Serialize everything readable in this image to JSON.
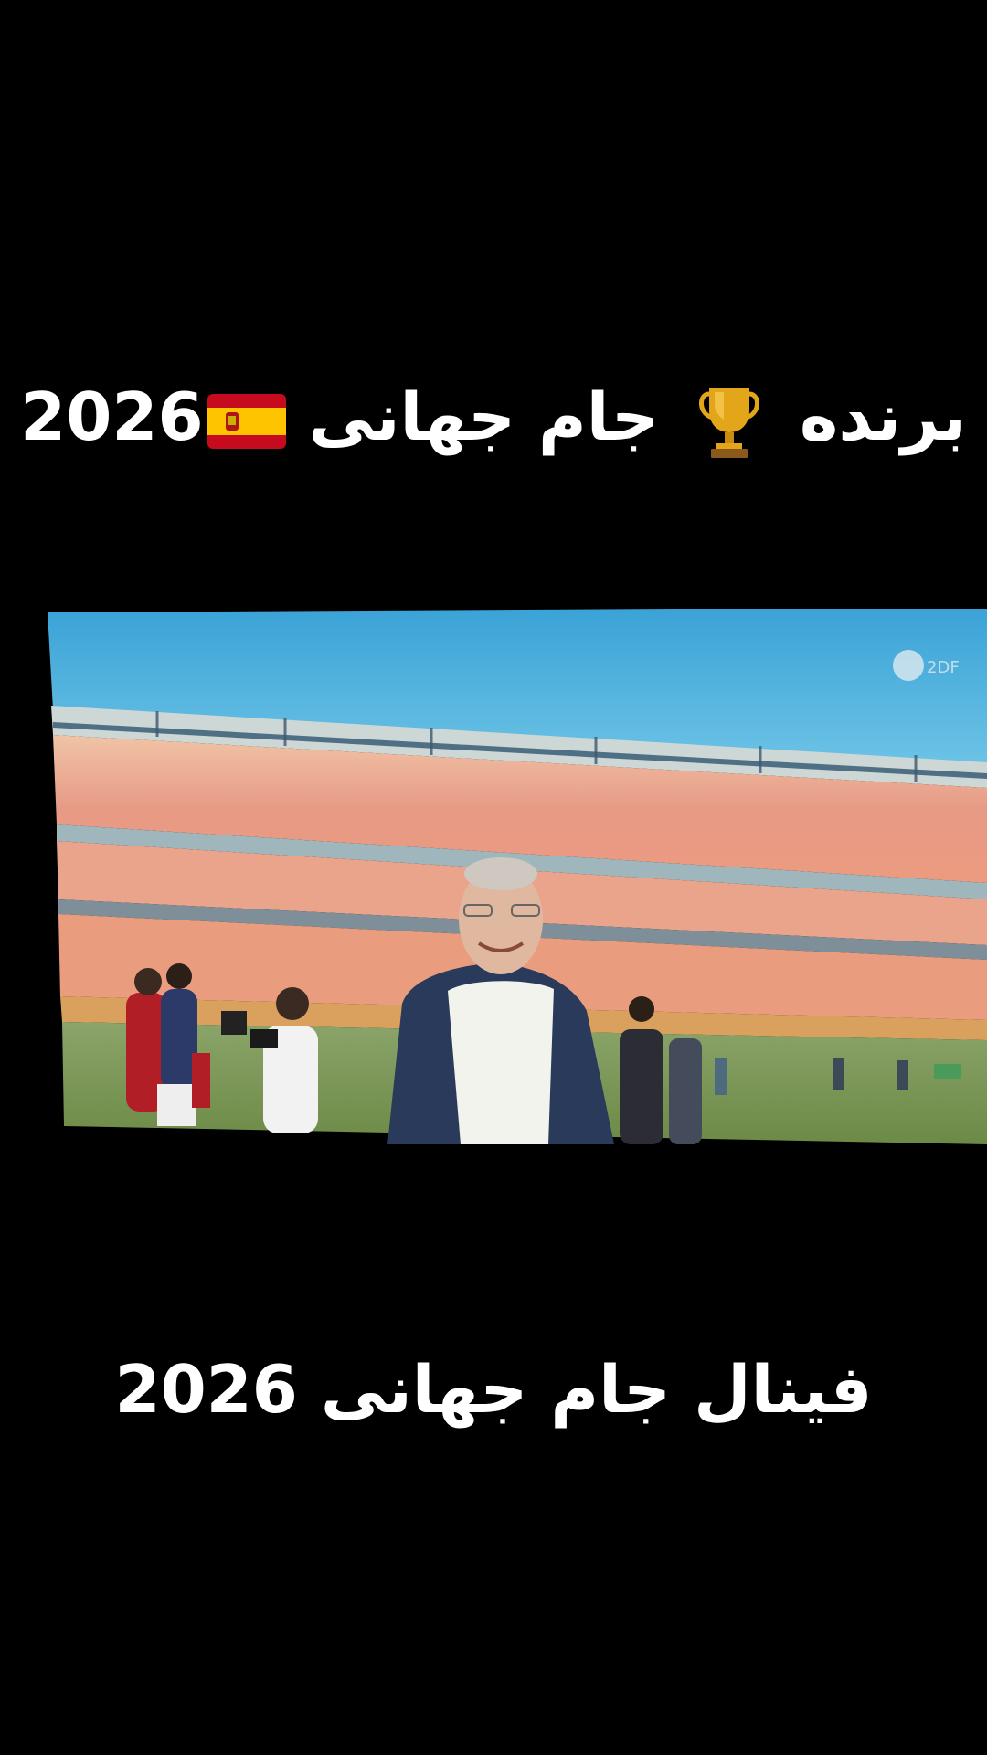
{
  "overlay": {
    "top_caption": {
      "word_winner": "برنده",
      "word_cup": "جام جهانی",
      "year": "2026",
      "trophy_icon": "trophy-emoji",
      "flag_icon": "spain-flag-emoji"
    },
    "bottom_caption": "فینال جام جهانی 2026"
  },
  "video": {
    "scene": "stadium-celebration",
    "broadcaster_logo": "zdf-watermark-icon"
  },
  "colors": {
    "background": "#000000",
    "sky": "#43a9d8",
    "crowd": "#e9a98f",
    "pitch": "#7f9a5a",
    "spain_red": "#c60b1e",
    "spain_yellow": "#ffc400",
    "trophy_gold": "#e3a51a"
  }
}
